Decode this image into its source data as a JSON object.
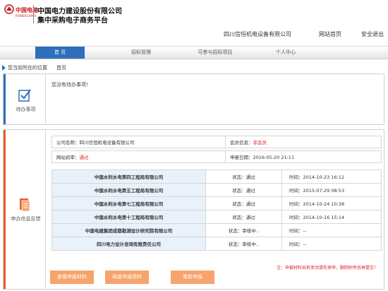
{
  "header": {
    "logo_cn": "中国电建",
    "logo_en": "POWERCHINA",
    "title_line1": "中国电力建设股份有限公司",
    "title_line2": "集中采购电子商务平台",
    "company": "四川信恒机电设备有限公司",
    "home_link": "网站首页",
    "logout": "安全退出"
  },
  "nav": {
    "items": [
      {
        "label": "首 页",
        "active": true
      },
      {
        "label": "招标管理",
        "active": false
      },
      {
        "label": "可参与招标项目",
        "active": false
      },
      {
        "label": "个人中心",
        "active": false
      }
    ]
  },
  "breadcrumb": {
    "prefix": "您当前所在的位置",
    "current": "首页"
  },
  "todo": {
    "label": "待办事项",
    "content": "您没有待办事项！"
  },
  "application": {
    "label": "申办信息反馈",
    "company_label": "公司名称：",
    "company_value": "四川信恒机电设备有限公司",
    "member_label": "会员信息：",
    "member_value": "非会员",
    "review_label": "网站初审：",
    "review_value": "通过",
    "apply_time_label": "申报日期：",
    "apply_time_value": "2016-05-20 21:11",
    "rows": [
      {
        "name": "中国水利水电第四工程局有限公司",
        "status": "状态：通过",
        "time": "时间：2014-10-23 16:12"
      },
      {
        "name": "中国水利水电第五工程局有限公司",
        "status": "状态：通过",
        "time": "时间：2015-07-29 08:53"
      },
      {
        "name": "中国水利水电第七工程局有限公司",
        "status": "状态：通过",
        "time": "时间：2014-10-24 10:38"
      },
      {
        "name": "中国水利水电第十工程局有限公司",
        "status": "状态：通过",
        "time": "时间：2014-10-16 15:14"
      },
      {
        "name": "中国电建集团成都勘测设计研究院有限公司",
        "status": "状态：审核中..",
        "time": "时间：--"
      },
      {
        "name": "四川电力设计咨询有限责任公司",
        "status": "状态：审核中..",
        "time": "时间：--"
      }
    ],
    "note": "注：申报材料如有变动请先审申，删除附件后再提交！",
    "buttons": [
      "查看申报材料",
      "再提申报资料",
      "重新申报"
    ]
  },
  "colors": {
    "nav_active": "#2f6ebd",
    "brand_red": "#c5161d",
    "button": "#f6a36c",
    "alert": "#e02020"
  }
}
